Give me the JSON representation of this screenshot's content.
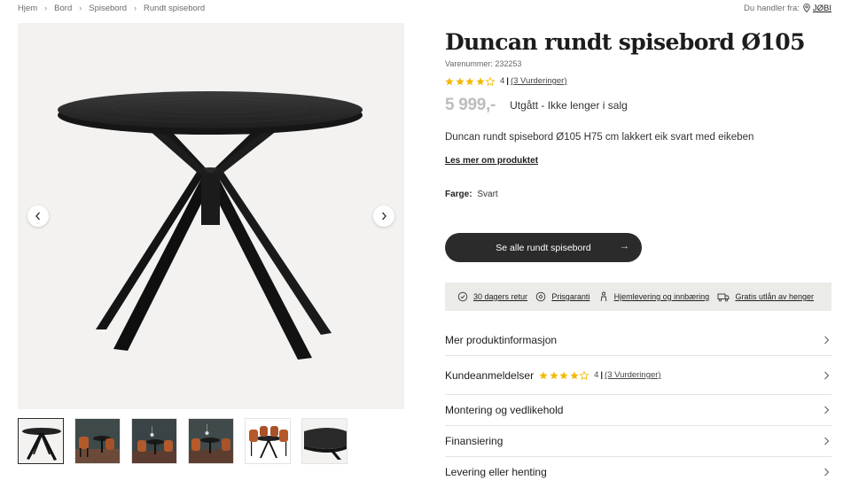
{
  "breadcrumb": [
    "Hjem",
    "Bord",
    "Spisebord",
    "Rundt spisebord"
  ],
  "store": {
    "label": "Du handler fra:",
    "name": "JØBI"
  },
  "product": {
    "title": "Duncan rundt spisebord Ø105",
    "sku": "Varenummer: 232253",
    "rating_value": "4",
    "rating_link": "(3 Vurderinger)",
    "price": "5 999,-",
    "status": "Utgått - Ikke lenger i salg",
    "description": "Duncan rundt spisebord Ø105 H75 cm lakkert eik svart med eikeben",
    "more_link": "Les mer om produktet",
    "color_label": "Farge:",
    "color_value": "Svart",
    "cta": "Se alle rundt spisebord",
    "cta_arrow": "→"
  },
  "usps": [
    {
      "icon": "return-icon",
      "label": "30 dagers retur"
    },
    {
      "icon": "price-guarantee-icon",
      "label": "Prisgaranti"
    },
    {
      "icon": "delivery-person-icon",
      "label": "Hjemlevering og innbæring"
    },
    {
      "icon": "trailer-icon",
      "label": "Gratis utlån av henger"
    }
  ],
  "accordion": [
    {
      "label": "Mer produktinformasjon"
    },
    {
      "label": "Kundeanmeldelser",
      "rating_value": "4",
      "rating_link": "(3 Vurderinger)"
    },
    {
      "label": "Montering og vedlikehold"
    },
    {
      "label": "Finansiering"
    },
    {
      "label": "Levering eller henting"
    }
  ],
  "rating": {
    "stars": 4,
    "max": 5,
    "color": "#f2b900"
  },
  "gallery": {
    "thumbnail_count": 6,
    "active_index": 0
  }
}
